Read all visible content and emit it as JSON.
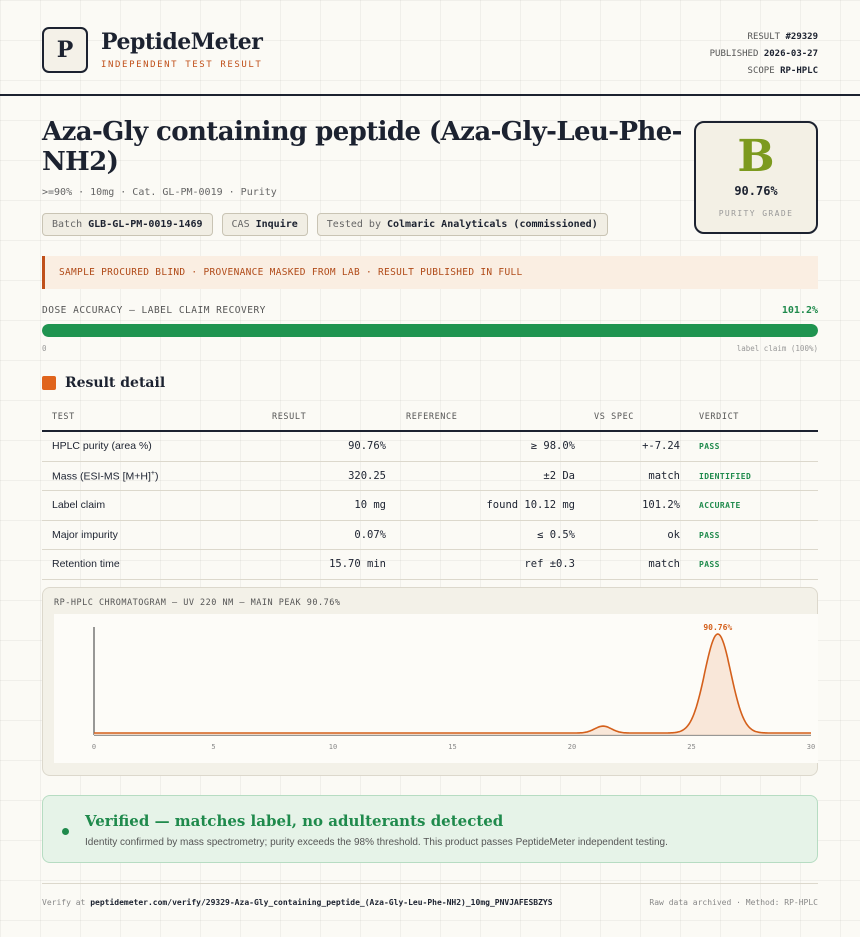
{
  "header": {
    "logo_letter": "P",
    "brand": "PeptideMeter",
    "brand_sub": "INDEPENDENT TEST RESULT",
    "result_label": "RESULT",
    "result_value": "#29329",
    "published_label": "PUBLISHED",
    "published_value": "2026-03-27",
    "scope_label": "SCOPE",
    "scope_value": "RP-HPLC"
  },
  "product": {
    "title": "Aza-Gly containing peptide (Aza-Gly-Leu-Phe-NH2)",
    "subline": ">=90% · 10mg · Cat. GL-PM-0019 · Purity",
    "batch_label": "Batch",
    "batch_value": "GLB-GL-PM-0019-1469",
    "cas_label": "CAS",
    "cas_value": "Inquire",
    "tested_label": "Tested by",
    "tested_value": "Colmaric Analyticals (commissioned)"
  },
  "grade": {
    "letter": "B",
    "value": "90.76%",
    "label": "PURITY GRADE"
  },
  "notice": "SAMPLE PROCURED BLIND · PROVENANCE MASKED FROM LAB · RESULT PUBLISHED IN FULL",
  "dose": {
    "label": "DOSE ACCURACY — LABEL CLAIM RECOVERY",
    "value": "101.2%",
    "fill_fraction": 1.0,
    "start_label": "0",
    "end_label": "label claim (100%)"
  },
  "section_title": "Result detail",
  "table": {
    "headers": {
      "test": "TEST",
      "result": "RESULT",
      "reference": "REFERENCE",
      "vs": "VS SPEC",
      "verdict": "VERDICT"
    },
    "rows": [
      {
        "test": "HPLC purity (area %)",
        "result": "90.76%",
        "reference": "≥ 98.0%",
        "vs": "+-7.24",
        "verdict": "PASS"
      },
      {
        "test": "Mass (ESI-MS [M+H]",
        "test_sup": "+",
        "test_end": ")",
        "result": "320.25",
        "reference": "±2 Da",
        "vs": "match",
        "verdict": "IDENTIFIED"
      },
      {
        "test": "Label claim",
        "result": "10 mg",
        "reference": "found 10.12 mg",
        "vs": "101.2%",
        "verdict": "ACCURATE"
      },
      {
        "test": "Major impurity",
        "result": "0.07%",
        "reference": "≤ 0.5%",
        "vs": "ok",
        "verdict": "PASS"
      },
      {
        "test": "Retention time",
        "result": "15.70 min",
        "reference": "ref ±0.3",
        "vs": "match",
        "verdict": "PASS"
      }
    ]
  },
  "chart_data": {
    "type": "line",
    "title": "RP-HPLC CHROMATOGRAM — UV 220 NM — MAIN PEAK 90.76%",
    "xlabel": "",
    "ylabel": "",
    "x_ticks": [
      "0",
      "5",
      "10",
      "15",
      "20",
      "25",
      "30"
    ],
    "xlim": [
      0,
      30
    ],
    "peaks": [
      {
        "rt": 21.3,
        "height": 0.07,
        "width": 0.35
      },
      {
        "rt": 26.1,
        "height": 1.0,
        "width": 0.55
      }
    ],
    "baseline": 0.02,
    "annotation": "90.76%",
    "annotation_x": 26.1,
    "grid": false,
    "line_color": "#d4601c",
    "fill_color": "#f8e3d4"
  },
  "verified": {
    "title": "Verified — matches label, no adulterants detected",
    "text": "Identity confirmed by mass spectrometry; purity exceeds the 98% threshold. This product passes PeptideMeter independent testing."
  },
  "footer": {
    "verify_label": "Verify at",
    "verify_url": "peptidemeter.com/verify/29329-Aza-Gly_containing_peptide_(Aza-Gly-Leu-Phe-NH2)_10mg_PNVJAFESBZYS",
    "right": "Raw data archived · Method: RP-HPLC"
  }
}
